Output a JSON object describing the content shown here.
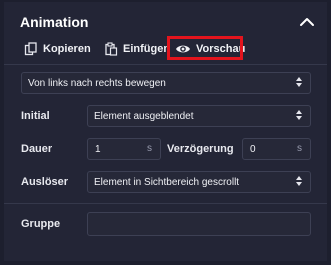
{
  "panel": {
    "title": "Animation",
    "highlight_color": "#e3141d"
  },
  "toolbar": {
    "copy_label": "Kopieren",
    "paste_label": "Einfügen",
    "preview_label": "Vorschau"
  },
  "effect": {
    "value": "Von links nach rechts bewegen"
  },
  "initial": {
    "label": "Initial",
    "value": "Element ausgeblendet"
  },
  "duration": {
    "label": "Dauer",
    "value": "1",
    "unit": "s"
  },
  "delay": {
    "label": "Verzögerung",
    "value": "0",
    "unit": "s"
  },
  "trigger": {
    "label": "Auslöser",
    "value": "Element in Sichtbereich gescrollt"
  },
  "group": {
    "label": "Gruppe",
    "value": ""
  },
  "icons": {
    "collapse": "chevron-up-icon",
    "copy": "copy-icon",
    "paste": "paste-icon",
    "preview": "eye-icon",
    "select_arrows": "up-down-arrows-icon"
  }
}
